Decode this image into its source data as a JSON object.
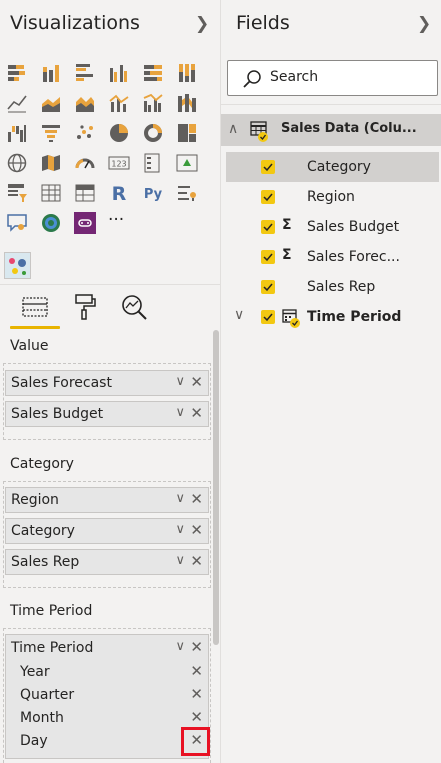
{
  "visualizations": {
    "title": "Visualizations",
    "collapse_icon": "chevron-right-icon",
    "more_label": "···",
    "r_label": "R",
    "py_label": "Py",
    "card_label": "123",
    "tabs": [
      "fields-well-icon",
      "format-paint-roller-icon",
      "analytics-magnifier-icon"
    ],
    "active_tab_color": "#e8b400",
    "wells": [
      {
        "label": "Value",
        "fields": [
          "Sales Forecast",
          "Sales Budget"
        ]
      },
      {
        "label": "Category",
        "fields": [
          "Region",
          "Category",
          "Sales Rep"
        ]
      },
      {
        "label": "Time Period",
        "group": "Time Period",
        "subfields": [
          "Year",
          "Quarter",
          "Month",
          "Day"
        ]
      }
    ],
    "highlight_color": "#e81123"
  },
  "fields": {
    "title": "Fields",
    "collapse_icon": "chevron-right-icon",
    "search": {
      "placeholder": "Search"
    },
    "table": {
      "name": "Sales Data (Colu...",
      "expanded": true
    },
    "items": [
      {
        "name": "Category",
        "checked": true,
        "aggregate": false
      },
      {
        "name": "Region",
        "checked": true,
        "aggregate": false
      },
      {
        "name": "Sales Budget",
        "checked": true,
        "aggregate": true,
        "symbol": "Σ"
      },
      {
        "name": "Sales Forec...",
        "checked": true,
        "aggregate": true,
        "symbol": "Σ"
      },
      {
        "name": "Sales Rep",
        "checked": true,
        "aggregate": false
      }
    ],
    "hierarchy": {
      "name": "Time Period",
      "checked": true,
      "expanded": false
    },
    "checkbox_color": "#f2c811"
  }
}
